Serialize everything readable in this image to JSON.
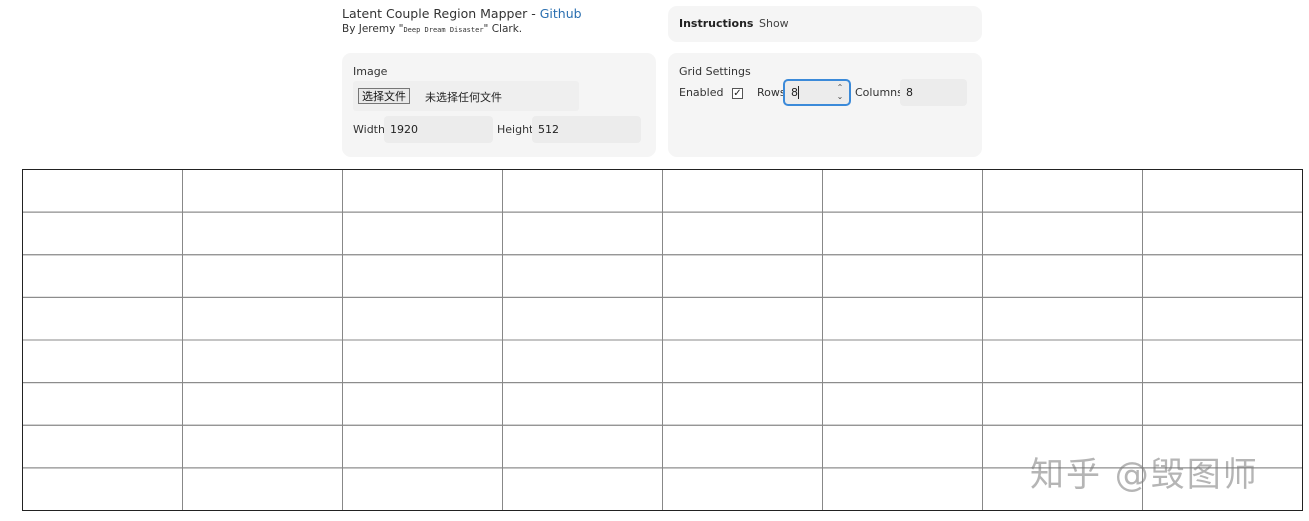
{
  "header": {
    "title_prefix": "Latent Couple Region Mapper - ",
    "github_link": "Github",
    "byline_prefix": "By Jeremy \"",
    "byline_nick": "Deep Dream Disaster",
    "byline_suffix": "\" Clark."
  },
  "instructions": {
    "label": "Instructions",
    "toggle": "Show"
  },
  "image_panel": {
    "label": "Image",
    "file_button": "选择文件",
    "file_status": "未选择任何文件",
    "width_label": "Width",
    "width_value": "1920",
    "height_label": "Height",
    "height_value": "512"
  },
  "grid_panel": {
    "label": "Grid Settings",
    "enabled_label": "Enabled",
    "enabled_checked": true,
    "check_mark": "✓",
    "rows_label": "Rows",
    "rows_value": "8",
    "columns_label": "Columns",
    "columns_value": "8",
    "spinner_up": "⌃",
    "spinner_down": "⌄"
  },
  "grid": {
    "rows": 8,
    "columns": 8,
    "line_color": "#888888",
    "border_color": "#222222"
  },
  "colors": {
    "link": "#2a6fb0",
    "panel_bg": "#f5f5f5",
    "focus_border": "#3b8ad9"
  },
  "watermark": "知乎 @毁图师"
}
